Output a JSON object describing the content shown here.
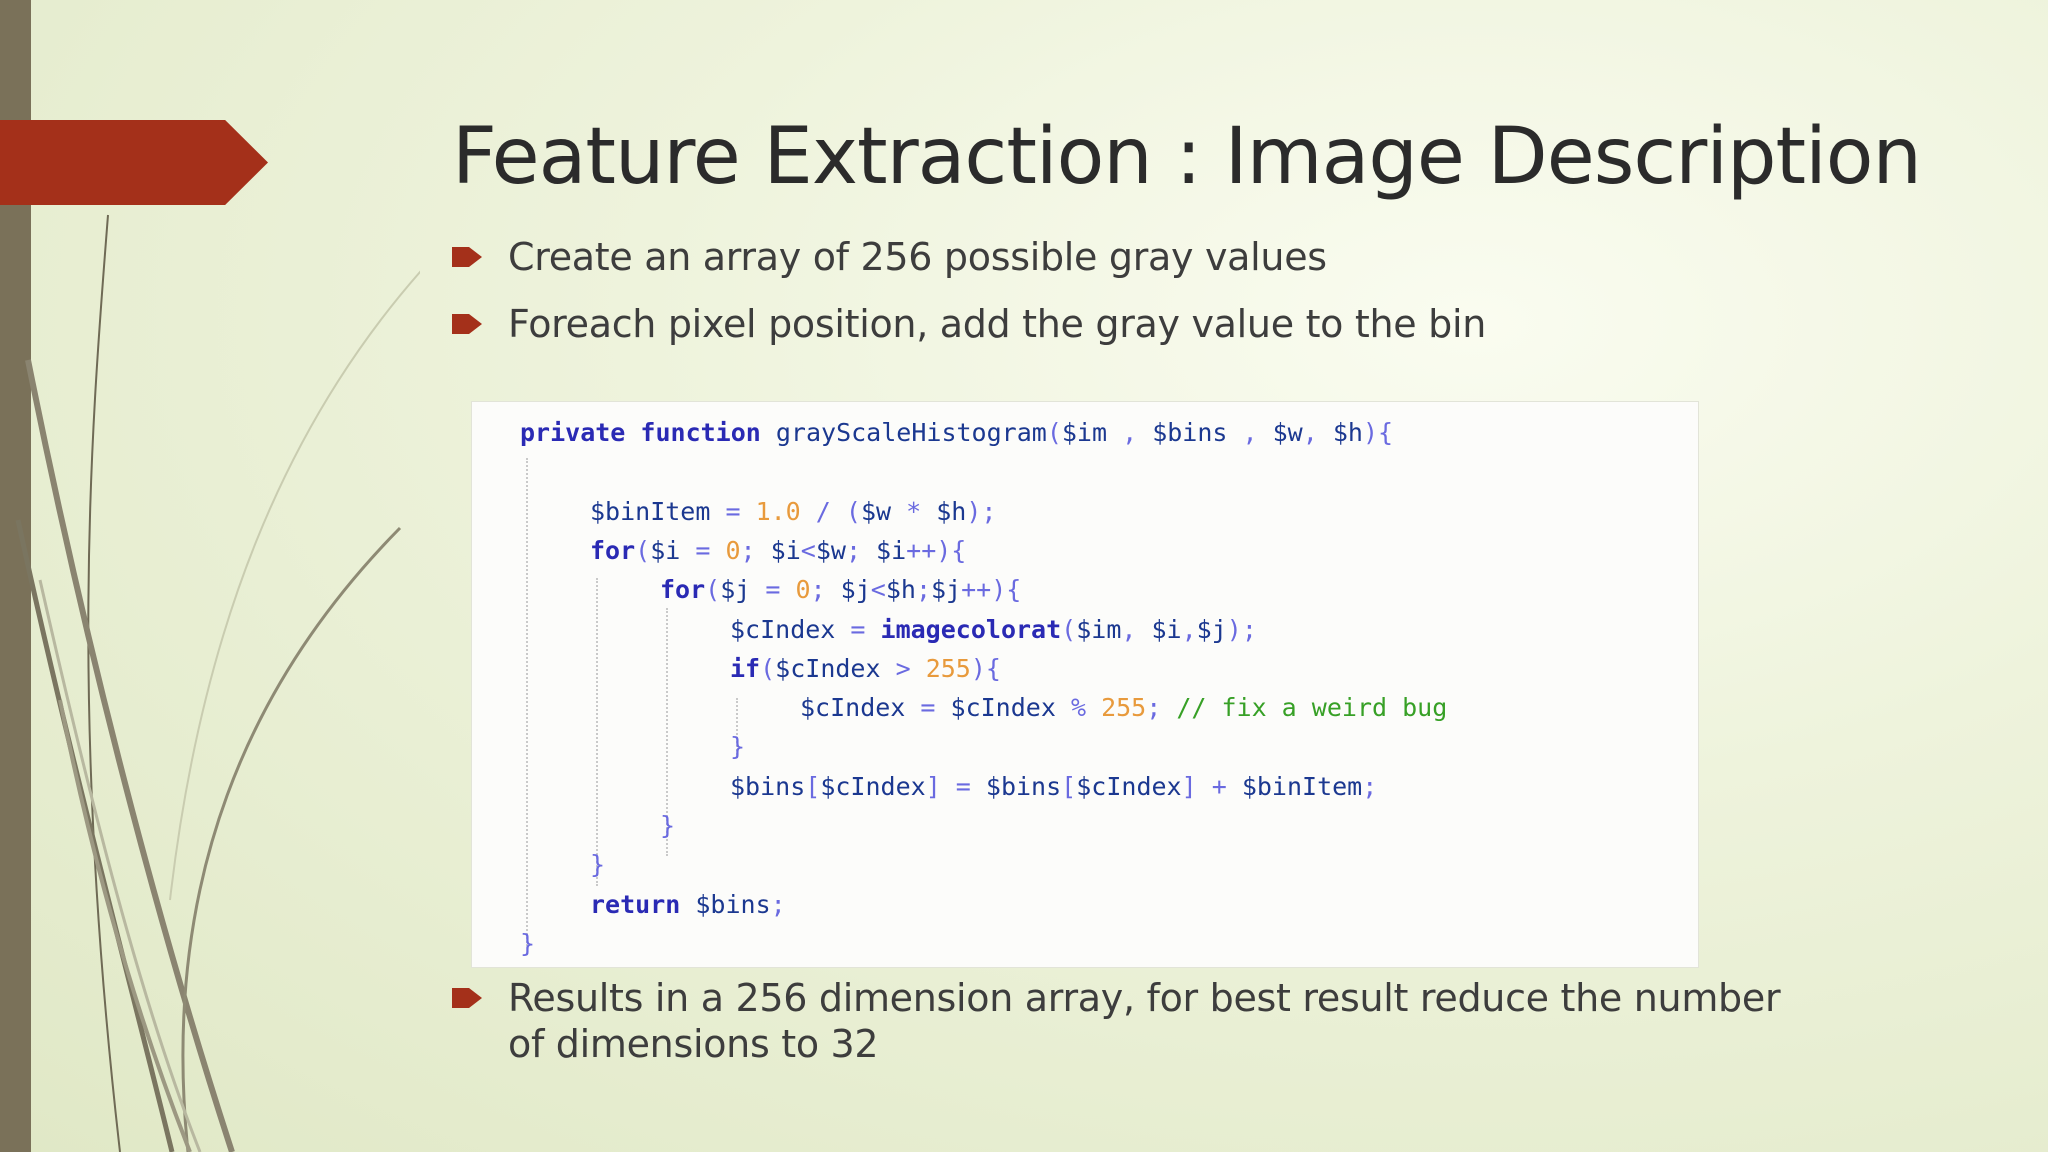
{
  "slide": {
    "title": "Feature Extraction :  Image Description",
    "bullets": [
      "Create an array of 256 possible gray values",
      "Foreach pixel position, add the gray value to the bin",
      "Results in a 256 dimension array, for best result reduce the number of dimensions to 32"
    ]
  },
  "code": {
    "lines": [
      {
        "indent": 0,
        "tokens": [
          {
            "t": "private function ",
            "c": "kw"
          },
          {
            "t": "grayScaleHistogram",
            "c": ""
          },
          {
            "t": "(",
            "c": "pun"
          },
          {
            "t": "$im ",
            "c": ""
          },
          {
            "t": ", ",
            "c": "pun"
          },
          {
            "t": "$bins ",
            "c": ""
          },
          {
            "t": ", ",
            "c": "pun"
          },
          {
            "t": "$w",
            "c": ""
          },
          {
            "t": ", ",
            "c": "pun"
          },
          {
            "t": "$h",
            "c": ""
          },
          {
            "t": "){",
            "c": "pun"
          }
        ]
      },
      {
        "indent": 0,
        "tokens": []
      },
      {
        "indent": 1,
        "tokens": [
          {
            "t": "$binItem ",
            "c": ""
          },
          {
            "t": "= ",
            "c": "pun"
          },
          {
            "t": "1.0 ",
            "c": "num"
          },
          {
            "t": "/ (",
            "c": "pun"
          },
          {
            "t": "$w ",
            "c": ""
          },
          {
            "t": "* ",
            "c": "pun"
          },
          {
            "t": "$h",
            "c": ""
          },
          {
            "t": ");",
            "c": "pun"
          }
        ]
      },
      {
        "indent": 1,
        "tokens": [
          {
            "t": "for",
            "c": "kw"
          },
          {
            "t": "(",
            "c": "pun"
          },
          {
            "t": "$i ",
            "c": ""
          },
          {
            "t": "= ",
            "c": "pun"
          },
          {
            "t": "0",
            "c": "num"
          },
          {
            "t": "; ",
            "c": "pun"
          },
          {
            "t": "$i",
            "c": ""
          },
          {
            "t": "<",
            "c": "pun"
          },
          {
            "t": "$w",
            "c": ""
          },
          {
            "t": "; ",
            "c": "pun"
          },
          {
            "t": "$i",
            "c": ""
          },
          {
            "t": "++){",
            "c": "pun"
          }
        ]
      },
      {
        "indent": 2,
        "tokens": [
          {
            "t": "for",
            "c": "kw"
          },
          {
            "t": "(",
            "c": "pun"
          },
          {
            "t": "$j ",
            "c": ""
          },
          {
            "t": "= ",
            "c": "pun"
          },
          {
            "t": "0",
            "c": "num"
          },
          {
            "t": "; ",
            "c": "pun"
          },
          {
            "t": "$j",
            "c": ""
          },
          {
            "t": "<",
            "c": "pun"
          },
          {
            "t": "$h",
            "c": ""
          },
          {
            "t": ";",
            "c": "pun"
          },
          {
            "t": "$j",
            "c": ""
          },
          {
            "t": "++){",
            "c": "pun"
          }
        ]
      },
      {
        "indent": 3,
        "tokens": [
          {
            "t": "$cIndex ",
            "c": ""
          },
          {
            "t": "= ",
            "c": "pun"
          },
          {
            "t": "imagecolorat",
            "c": "kw"
          },
          {
            "t": "(",
            "c": "pun"
          },
          {
            "t": "$im",
            "c": ""
          },
          {
            "t": ", ",
            "c": "pun"
          },
          {
            "t": "$i",
            "c": ""
          },
          {
            "t": ",",
            "c": "pun"
          },
          {
            "t": "$j",
            "c": ""
          },
          {
            "t": ");",
            "c": "pun"
          }
        ]
      },
      {
        "indent": 3,
        "tokens": [
          {
            "t": "if",
            "c": "kw"
          },
          {
            "t": "(",
            "c": "pun"
          },
          {
            "t": "$cIndex ",
            "c": ""
          },
          {
            "t": "> ",
            "c": "pun"
          },
          {
            "t": "255",
            "c": "num"
          },
          {
            "t": "){",
            "c": "pun"
          }
        ]
      },
      {
        "indent": 4,
        "tokens": [
          {
            "t": "$cIndex ",
            "c": ""
          },
          {
            "t": "= ",
            "c": "pun"
          },
          {
            "t": "$cIndex ",
            "c": ""
          },
          {
            "t": "% ",
            "c": "pun"
          },
          {
            "t": "255",
            "c": "num"
          },
          {
            "t": "; ",
            "c": "pun"
          },
          {
            "t": "// fix a weird bug",
            "c": "com"
          }
        ]
      },
      {
        "indent": 3,
        "tokens": [
          {
            "t": "}",
            "c": "pun"
          }
        ]
      },
      {
        "indent": 3,
        "tokens": [
          {
            "t": "$bins",
            "c": ""
          },
          {
            "t": "[",
            "c": "pun"
          },
          {
            "t": "$cIndex",
            "c": ""
          },
          {
            "t": "] = ",
            "c": "pun"
          },
          {
            "t": "$bins",
            "c": ""
          },
          {
            "t": "[",
            "c": "pun"
          },
          {
            "t": "$cIndex",
            "c": ""
          },
          {
            "t": "] + ",
            "c": "pun"
          },
          {
            "t": "$binItem",
            "c": ""
          },
          {
            "t": ";",
            "c": "pun"
          }
        ]
      },
      {
        "indent": 2,
        "tokens": [
          {
            "t": "}",
            "c": "pun"
          }
        ]
      },
      {
        "indent": 1,
        "tokens": [
          {
            "t": "}",
            "c": "pun"
          }
        ]
      },
      {
        "indent": 1,
        "tokens": [
          {
            "t": "return ",
            "c": "kw"
          },
          {
            "t": "$bins",
            "c": ""
          },
          {
            "t": ";",
            "c": "pun"
          }
        ]
      },
      {
        "indent": 0,
        "tokens": [
          {
            "t": "}",
            "c": "pun"
          }
        ]
      }
    ]
  },
  "colors": {
    "accent_arrow": "#a4301a",
    "left_bar": "#7a7159",
    "code_keyword": "#2a2ab4",
    "code_variable": "#1b3890",
    "code_number": "#e89a3c",
    "code_comment": "#37a026"
  },
  "icons": {
    "bullet_marker": "red-arrow-bullet-icon",
    "decoration": "grass-stems-decoration"
  }
}
